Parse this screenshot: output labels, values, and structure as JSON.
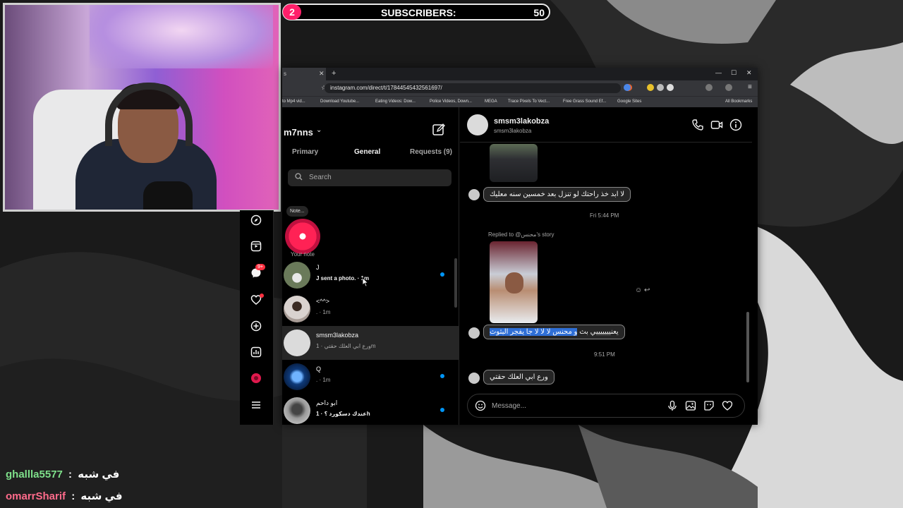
{
  "colors": {
    "accent_pink": "#ff1f6a",
    "ig_blue": "#0095f6",
    "user1_color": "#7ee08a",
    "user2_color": "#ff6b8b",
    "highlight": "#2f6fd6"
  },
  "overlay": {
    "subscribers_count_left": "2",
    "subscribers_label": "SUBSCRIBERS:",
    "subscribers_value": "50"
  },
  "browser": {
    "tab_title": "s",
    "url": "instagram.com/direct/t/17844545432561697/",
    "bookmarks": [
      "to Mp4 vid...",
      "Download Youtube...",
      "Eating Videos: Dow...",
      "Police Videos, Down...",
      "MEGA",
      "Trace Pixels To Vect...",
      "Free Grass Sound Ef...",
      "Google Sites",
      "All Bookmarks"
    ]
  },
  "dm": {
    "account": "m7nns",
    "tabs": [
      "Primary",
      "General",
      "Requests (9)"
    ],
    "search_placeholder": "Search",
    "note_bubble": "Note...",
    "note_label": "Your note",
    "rail_badge": "9+",
    "conversations": [
      {
        "name": "J",
        "last": "J sent a photo. · 1m",
        "unread": true,
        "bold": true
      },
      {
        "name": "<^^>",
        "last": ". · 1m",
        "unread": false,
        "bold": false
      },
      {
        "name": "smsm3lakobza",
        "last": "ورع ابي العلك حقتي · 1m",
        "unread": false,
        "bold": false,
        "active": true
      },
      {
        "name": "Q",
        "last": ". · 1m",
        "unread": true,
        "bold": false
      },
      {
        "name": "ابو داحم",
        "last": "عندك دسكورد ؟ · 1h",
        "unread": true,
        "bold": true
      }
    ]
  },
  "chat": {
    "title": "smsm3lakobza",
    "subtitle": "smsm3lakobza",
    "messages": {
      "m1": "لا ابد خذ راحتك لو تنزل بعد خمسين سنه معليك",
      "time1": "Fri 5:44 PM",
      "reply_meta": "Replied to @محنس's story",
      "m2_plain": "يعنيييييييي بث",
      "m2_highlight": "و محنس لا لا لا جا يفجر البثوث",
      "time2": "9:51 PM",
      "m3": "ورع ابي العلك حقتي"
    },
    "composer_placeholder": "Message..."
  },
  "stream_chat": [
    {
      "user": "ghallla5577",
      "sep": " : ",
      "msg": "في شبه"
    },
    {
      "user": "omarrSharif",
      "sep": " : ",
      "msg": "في شبه"
    }
  ]
}
